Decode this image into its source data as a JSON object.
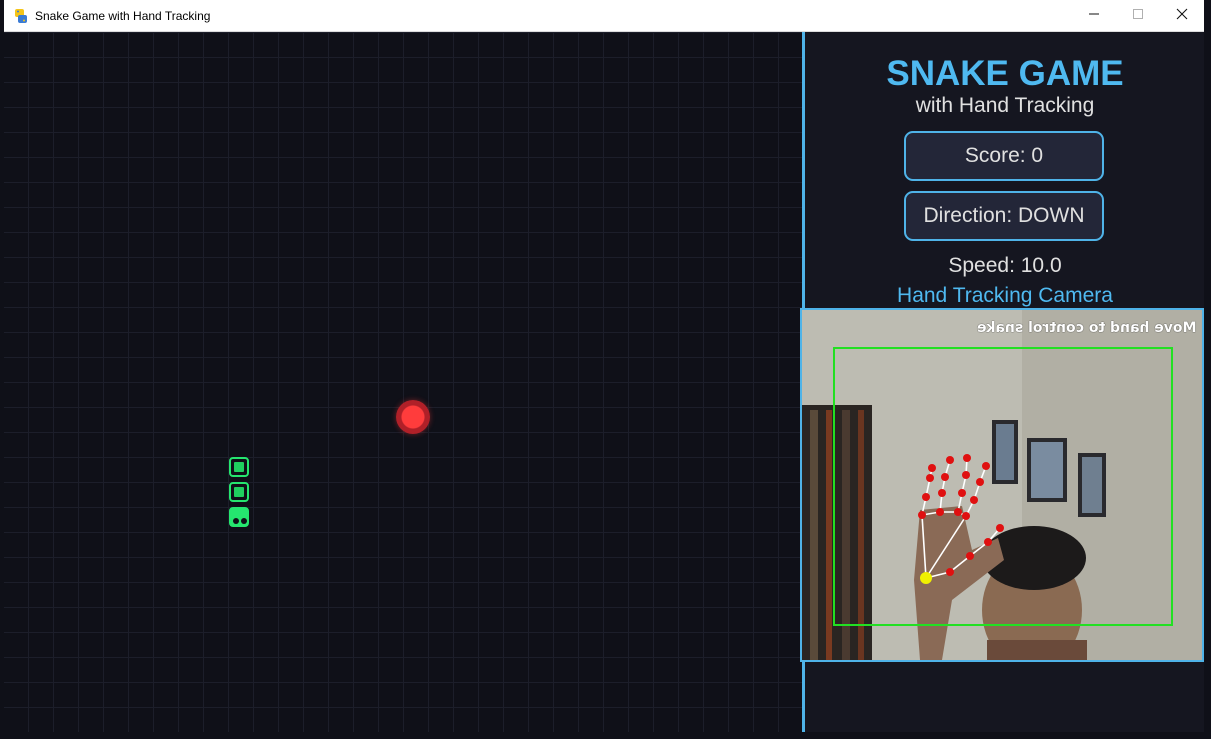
{
  "window": {
    "title": "Snake Game with Hand Tracking",
    "app_icon": "python-icon",
    "minimize_icon": "minimize-icon",
    "maximize_icon": "maximize-icon",
    "close_icon": "close-icon"
  },
  "game": {
    "snake_color": "#25e66f",
    "food_color": "#ff3c3c",
    "background_color": "#0f1018"
  },
  "sidebar": {
    "title": "SNAKE GAME",
    "subtitle": "with Hand Tracking",
    "score_text": "Score: 0",
    "direction_text": "Direction: DOWN",
    "speed_text": "Speed: 10.0",
    "camera_label": "Hand Tracking Camera",
    "accent_color": "#4fb3e8"
  },
  "camera": {
    "overlay_text": "Move hand to control snake"
  }
}
